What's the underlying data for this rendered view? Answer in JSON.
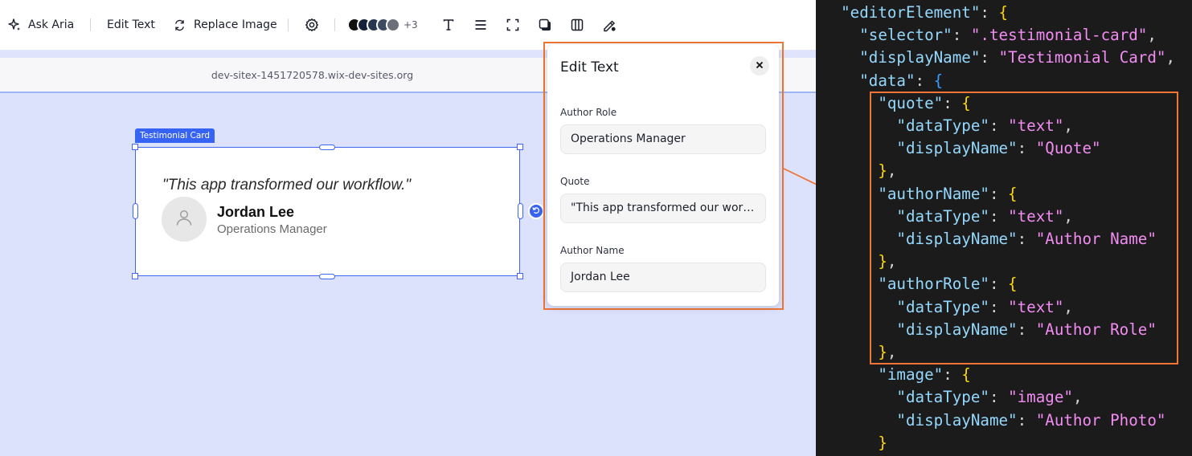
{
  "toolbar": {
    "ask_aria": "Ask Aria",
    "edit_text": "Edit Text",
    "replace_image": "Replace Image",
    "swatch_colors": [
      "#111111",
      "#14233a",
      "#26364f",
      "#3d4a60",
      "#6d6f78"
    ],
    "swatch_more": "+3",
    "icons": [
      "sparkle-icon",
      "replace-image-icon",
      "gear-icon",
      "text-icon",
      "align-icon",
      "crop-frame-icon",
      "shadow-icon",
      "columns-icon",
      "design-brush-icon"
    ]
  },
  "browser": {
    "url": "dev-sitex-1451720578.wix-dev-sites.org"
  },
  "canvas": {
    "selection_label": "Testimonial Card",
    "card": {
      "quote": "\"This app transformed our workflow.\"",
      "author_name": "Jordan Lee",
      "author_role": "Operations Manager"
    }
  },
  "edit_panel": {
    "title": "Edit Text",
    "fields": [
      {
        "label": "Author Role",
        "value": "Operations Manager"
      },
      {
        "label": "Quote",
        "value": "\"This app transformed our workfl…"
      },
      {
        "label": "Author Name",
        "value": "Jordan Lee"
      }
    ]
  },
  "code": {
    "lines": [
      [
        {
          "t": "  ",
          "c": "p"
        },
        {
          "t": "\"editorElement\"",
          "c": "k"
        },
        {
          "t": ": ",
          "c": "p"
        },
        {
          "t": "{",
          "c": "b1"
        }
      ],
      [
        {
          "t": "    ",
          "c": "p"
        },
        {
          "t": "\"selector\"",
          "c": "k"
        },
        {
          "t": ": ",
          "c": "p"
        },
        {
          "t": "\".testimonial-card\"",
          "c": "s"
        },
        {
          "t": ",",
          "c": "p"
        }
      ],
      [
        {
          "t": "    ",
          "c": "p"
        },
        {
          "t": "\"displayName\"",
          "c": "k"
        },
        {
          "t": ": ",
          "c": "p"
        },
        {
          "t": "\"Testimonial Card\"",
          "c": "s"
        },
        {
          "t": ",",
          "c": "p"
        }
      ],
      [
        {
          "t": "    ",
          "c": "p"
        },
        {
          "t": "\"data\"",
          "c": "k"
        },
        {
          "t": ": ",
          "c": "p"
        },
        {
          "t": "{",
          "c": "b2"
        }
      ],
      [
        {
          "t": "      ",
          "c": "p"
        },
        {
          "t": "\"quote\"",
          "c": "k"
        },
        {
          "t": ": ",
          "c": "p"
        },
        {
          "t": "{",
          "c": "b1"
        }
      ],
      [
        {
          "t": "        ",
          "c": "p"
        },
        {
          "t": "\"dataType\"",
          "c": "k"
        },
        {
          "t": ": ",
          "c": "p"
        },
        {
          "t": "\"text\"",
          "c": "s"
        },
        {
          "t": ",",
          "c": "p"
        }
      ],
      [
        {
          "t": "        ",
          "c": "p"
        },
        {
          "t": "\"displayName\"",
          "c": "k"
        },
        {
          "t": ": ",
          "c": "p"
        },
        {
          "t": "\"Quote\"",
          "c": "s"
        }
      ],
      [
        {
          "t": "      ",
          "c": "p"
        },
        {
          "t": "}",
          "c": "b1"
        },
        {
          "t": ",",
          "c": "p"
        }
      ],
      [
        {
          "t": "      ",
          "c": "p"
        },
        {
          "t": "\"authorName\"",
          "c": "k"
        },
        {
          "t": ": ",
          "c": "p"
        },
        {
          "t": "{",
          "c": "b1"
        }
      ],
      [
        {
          "t": "        ",
          "c": "p"
        },
        {
          "t": "\"dataType\"",
          "c": "k"
        },
        {
          "t": ": ",
          "c": "p"
        },
        {
          "t": "\"text\"",
          "c": "s"
        },
        {
          "t": ",",
          "c": "p"
        }
      ],
      [
        {
          "t": "        ",
          "c": "p"
        },
        {
          "t": "\"displayName\"",
          "c": "k"
        },
        {
          "t": ": ",
          "c": "p"
        },
        {
          "t": "\"Author Name\"",
          "c": "s"
        }
      ],
      [
        {
          "t": "      ",
          "c": "p"
        },
        {
          "t": "}",
          "c": "b1"
        },
        {
          "t": ",",
          "c": "p"
        }
      ],
      [
        {
          "t": "      ",
          "c": "p"
        },
        {
          "t": "\"authorRole\"",
          "c": "k"
        },
        {
          "t": ": ",
          "c": "p"
        },
        {
          "t": "{",
          "c": "b1"
        }
      ],
      [
        {
          "t": "        ",
          "c": "p"
        },
        {
          "t": "\"dataType\"",
          "c": "k"
        },
        {
          "t": ": ",
          "c": "p"
        },
        {
          "t": "\"text\"",
          "c": "s"
        },
        {
          "t": ",",
          "c": "p"
        }
      ],
      [
        {
          "t": "        ",
          "c": "p"
        },
        {
          "t": "\"displayName\"",
          "c": "k"
        },
        {
          "t": ": ",
          "c": "p"
        },
        {
          "t": "\"Author Role\"",
          "c": "s"
        }
      ],
      [
        {
          "t": "      ",
          "c": "p"
        },
        {
          "t": "}",
          "c": "b1"
        },
        {
          "t": ",",
          "c": "p"
        }
      ],
      [
        {
          "t": "      ",
          "c": "p"
        },
        {
          "t": "\"image\"",
          "c": "k"
        },
        {
          "t": ": ",
          "c": "p"
        },
        {
          "t": "{",
          "c": "b1"
        }
      ],
      [
        {
          "t": "        ",
          "c": "p"
        },
        {
          "t": "\"dataType\"",
          "c": "k"
        },
        {
          "t": ": ",
          "c": "p"
        },
        {
          "t": "\"image\"",
          "c": "s"
        },
        {
          "t": ",",
          "c": "p"
        }
      ],
      [
        {
          "t": "        ",
          "c": "p"
        },
        {
          "t": "\"displayName\"",
          "c": "k"
        },
        {
          "t": ": ",
          "c": "p"
        },
        {
          "t": "\"Author Photo\"",
          "c": "s"
        }
      ],
      [
        {
          "t": "      ",
          "c": "p"
        },
        {
          "t": "}",
          "c": "b1"
        }
      ]
    ]
  },
  "colors": {
    "accent": "#3763f4",
    "highlight": "#ef7534",
    "canvas": "#dde2fc"
  }
}
